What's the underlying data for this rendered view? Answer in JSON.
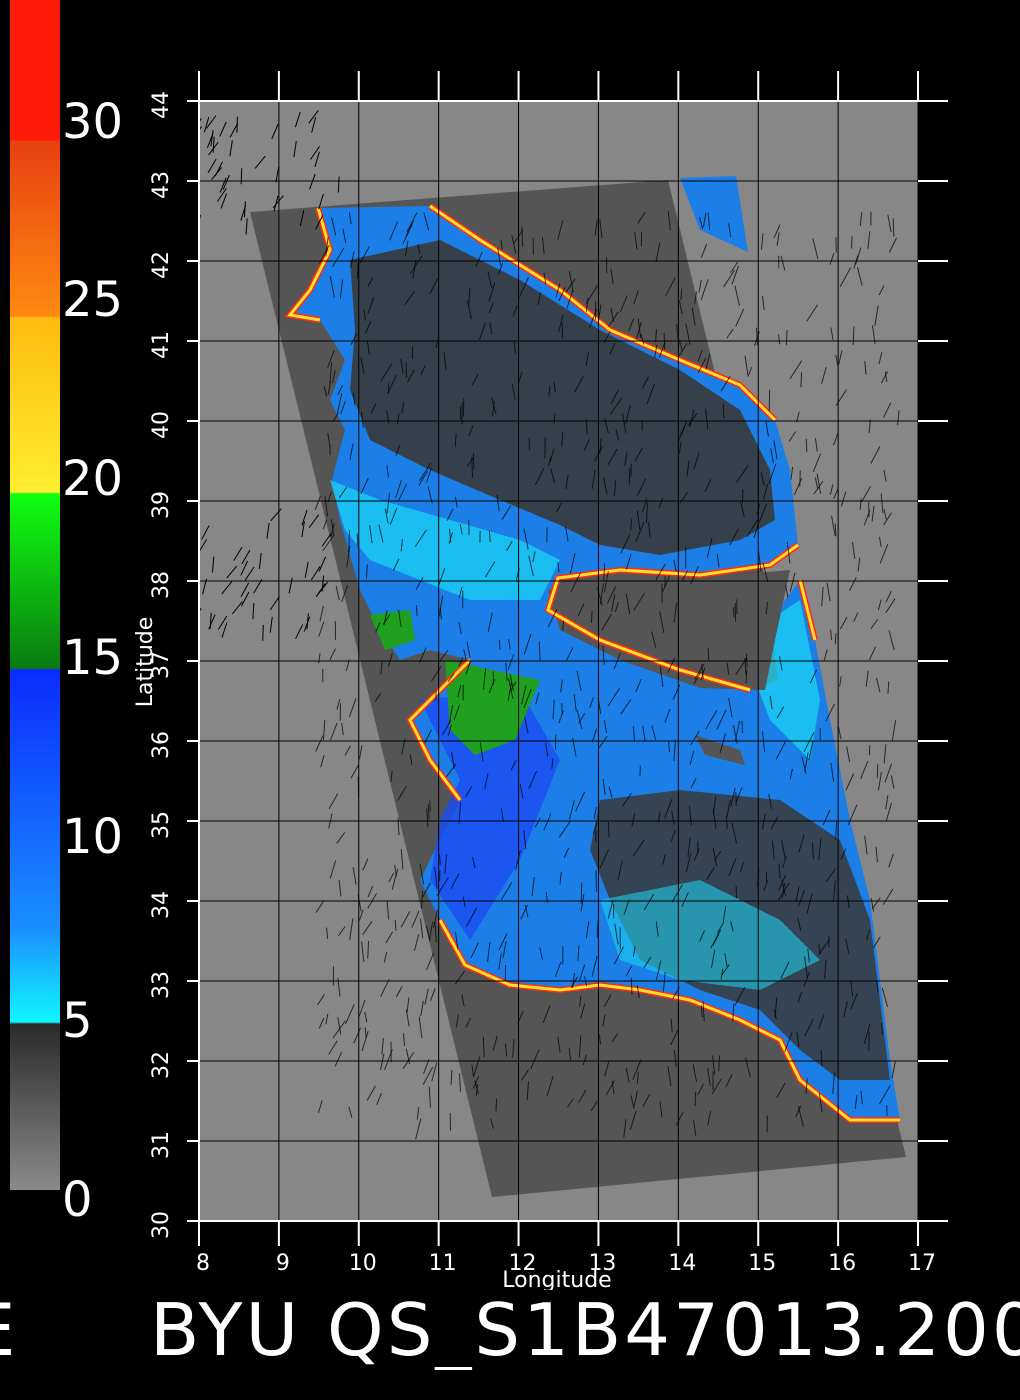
{
  "colorbar": {
    "labels": [
      "30",
      "25",
      "20",
      "15",
      "10",
      "5",
      "0"
    ],
    "colors": {
      "red": "#ff1a0a",
      "orange": "#ff7a10",
      "yellow": "#ffee30",
      "green": "#10ff10",
      "darkgreen": "#0a7a10",
      "blue": "#0a2cff",
      "cyan": "#10f6ff",
      "darkgray": "#2a2a2a",
      "lightgray": "#8a8a8a"
    }
  },
  "map": {
    "xlabel": "Longitude",
    "ylabel": "Latitude",
    "lon_ticks": [
      "8",
      "9",
      "10",
      "11",
      "12",
      "13",
      "14",
      "15",
      "16",
      "17"
    ],
    "lat_ticks": [
      "30",
      "31",
      "32",
      "33",
      "34",
      "35",
      "36",
      "37",
      "38",
      "39",
      "40",
      "41",
      "42",
      "43",
      "44"
    ],
    "lon_range": [
      8,
      17
    ],
    "lat_range": [
      30,
      44
    ],
    "colors": {
      "background": "#878787",
      "swath": "#555555",
      "ocean_low": "#3a3a3a",
      "ocean_cyan": "#19d8f5",
      "ocean_blue": "#1c7fe8",
      "ocean_deep": "#1a4ff0",
      "land_green": "#1fa01f"
    }
  },
  "footer": {
    "prefix": "E",
    "title": "BYU QS_S1B47013.200"
  }
}
